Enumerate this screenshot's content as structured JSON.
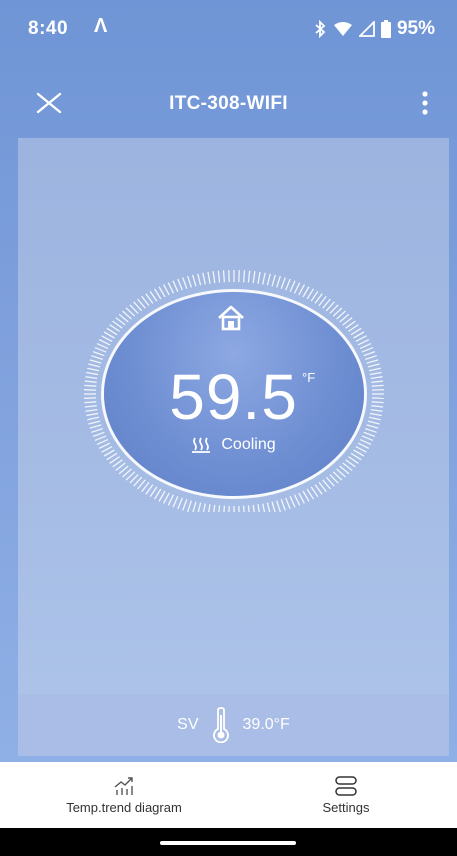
{
  "status_bar": {
    "time": "8:40",
    "app_icon": "Λ",
    "icons": [
      "bluetooth-icon",
      "wifi-icon",
      "signal-icon",
      "battery-icon"
    ],
    "battery": "95%"
  },
  "app_bar": {
    "title": "ITC-308-WIFI",
    "close_icon": "close-icon",
    "menu_icon": "more-vert-icon"
  },
  "thermostat": {
    "home_icon": "home-icon",
    "temperature": "59.5",
    "unit": "°F",
    "mode_icon": "heat-waves-icon",
    "mode_label": "Cooling",
    "sv_label": "SV",
    "sv_icon": "thermometer-icon",
    "sv_value": "39.0°F"
  },
  "bottom_nav": {
    "items": [
      {
        "label": "Temp.trend diagram",
        "icon": "trend-chart-icon"
      },
      {
        "label": "Settings",
        "icon": "settings-toggle-icon"
      }
    ]
  },
  "colors": {
    "background": "#7fa0dc",
    "panel": "#a4bbe4",
    "dial": "#6f8fd3",
    "text": "#ffffff"
  }
}
